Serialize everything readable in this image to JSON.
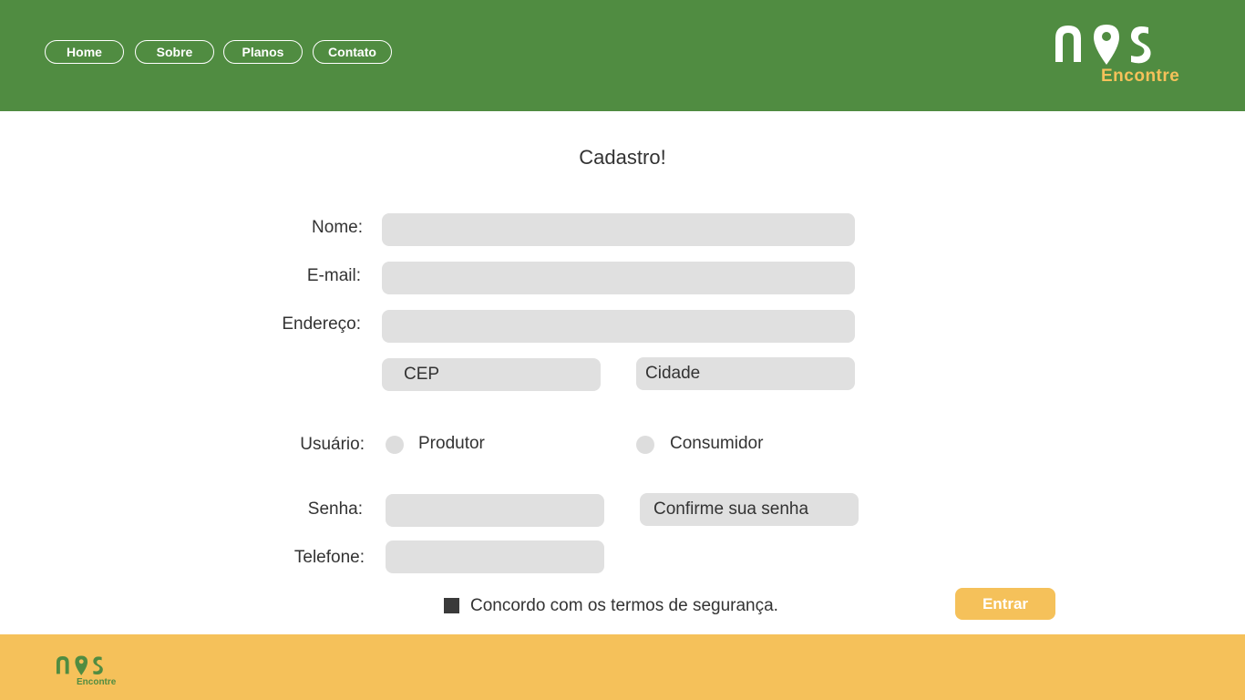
{
  "nav": {
    "home": "Home",
    "sobre": "Sobre",
    "planos": "Planos",
    "contato": "Contato"
  },
  "brand": {
    "subtitle": "Encontre",
    "logo_icon": "location-pin-icon",
    "colors": {
      "green": "#508c41",
      "yellow": "#f5c15a"
    }
  },
  "form": {
    "title": "Cadastro!",
    "nome_label": "Nome:",
    "email_label": "E-mail:",
    "endereco_label": "Endereço:",
    "cep_placeholder": "CEP",
    "cidade_placeholder": "Cidade",
    "usuario_label": "Usuário:",
    "produtor_label": "Produtor",
    "consumidor_label": "Consumidor",
    "senha_label": "Senha:",
    "confirm_placeholder": "Confirme sua senha",
    "telefone_label": "Telefone:",
    "terms_label": "Concordo com os termos de segurança.",
    "submit_label": "Entrar"
  }
}
